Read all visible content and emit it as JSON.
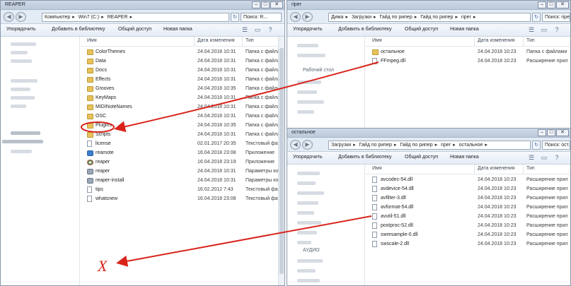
{
  "colors": {
    "arrow": "#d9231a",
    "folder": "#e7c15a",
    "titlebar": "#c6d3e3"
  },
  "toolbar": {
    "organize": "Упорядочить",
    "add_to_library": "Добавить в библиотеку",
    "share": "Общий доступ",
    "new_folder": "Новая папка"
  },
  "columns": {
    "name": "Имя",
    "date": "Дата изменения",
    "type": "Тип"
  },
  "win_reaper": {
    "title": "REAPER",
    "crumbs": [
      "Компьютер",
      "Win7 (C:)",
      "REAPER"
    ],
    "search": "Поиск: R...",
    "rows": [
      {
        "icon": "folder",
        "name": "ColorThemes",
        "date": "24.04.2018 10:31",
        "type": "Папка с файлами"
      },
      {
        "icon": "folder",
        "name": "Data",
        "date": "24.04.2018 10:31",
        "type": "Папка с файлами"
      },
      {
        "icon": "folder",
        "name": "Docs",
        "date": "24.04.2018 10:31",
        "type": "Папка с файлами"
      },
      {
        "icon": "folder",
        "name": "Effects",
        "date": "24.04.2018 10:31",
        "type": "Папка с файлами"
      },
      {
        "icon": "folder",
        "name": "Grooves",
        "date": "24.04.2018 10:35",
        "type": "Папка с файлами"
      },
      {
        "icon": "folder",
        "name": "KeyMaps",
        "date": "24.04.2018 10:31",
        "type": "Папка с файлами"
      },
      {
        "icon": "folder",
        "name": "MIDINoteNames",
        "date": "24.04.2018 10:31",
        "type": "Папка с файлами"
      },
      {
        "icon": "folder",
        "name": "OSC",
        "date": "24.04.2018 10:31",
        "type": "Папка с файлами"
      },
      {
        "icon": "folder",
        "name": "Plugins",
        "date": "24.04.2018 10:35",
        "type": "Папка с файлами"
      },
      {
        "icon": "folder",
        "name": "Scripts",
        "date": "24.04.2018 10:31",
        "type": "Папка с файлами"
      },
      {
        "icon": "file",
        "name": "license",
        "date": "02.01.2017 20:35",
        "type": "Текстовый файл"
      },
      {
        "icon": "app",
        "name": "reamote",
        "date": "16.04.2018 23:08",
        "type": "Приложение"
      },
      {
        "icon": "reaper",
        "name": "reaper",
        "date": "16.04.2018 23:19",
        "type": "Приложение"
      },
      {
        "icon": "gear",
        "name": "reaper",
        "date": "24.04.2018 10:31",
        "type": "Параметры конфигу..."
      },
      {
        "icon": "gear",
        "name": "reaper-install",
        "date": "24.04.2018 10:31",
        "type": "Параметры конфигу..."
      },
      {
        "icon": "file",
        "name": "tips",
        "date": "16.02.2012 7:43",
        "type": "Текстовый файл"
      },
      {
        "icon": "file",
        "name": "whatsnew",
        "date": "16.04.2018 23:08",
        "type": "Текстовый файл"
      }
    ]
  },
  "win_riper": {
    "title": "riper",
    "crumbs": [
      "Дима",
      "Загрузки",
      "Гайд по рипер",
      "Гайд по рипер",
      "riper"
    ],
    "search": "Поиск: riper",
    "nav_text": "Рабочий стол",
    "rows": [
      {
        "icon": "folder",
        "name": "остальное",
        "date": "24.04.2018 10:23",
        "type": "Папка с файлами"
      },
      {
        "icon": "file",
        "name": "FFmpeg.dll",
        "date": "24.04.2018 10:23",
        "type": "Расширение прил"
      }
    ]
  },
  "win_ost": {
    "title": "остальное",
    "crumbs": [
      "Загрузки",
      "Гайд по рипер",
      "Гайд по рипер",
      "riper",
      "остальное"
    ],
    "search": "Поиск: ост...",
    "nav_text": "АУДИО",
    "rows": [
      {
        "icon": "file",
        "name": "avcodec-54.dll",
        "date": "24.04.2018 10:23",
        "type": "Расширение прил"
      },
      {
        "icon": "file",
        "name": "avdevice-54.dll",
        "date": "24.04.2018 10:23",
        "type": "Расширение прил"
      },
      {
        "icon": "file",
        "name": "avfilter-3.dll",
        "date": "24.04.2018 10:23",
        "type": "Расширение прил"
      },
      {
        "icon": "file",
        "name": "avformat-54.dll",
        "date": "24.04.2018 10:23",
        "type": "Расширение прил"
      },
      {
        "icon": "file",
        "name": "avutil-51.dll",
        "date": "24.04.2018 10:23",
        "type": "Расширение прил"
      },
      {
        "icon": "file",
        "name": "postproc-52.dll",
        "date": "24.04.2018 10:23",
        "type": "Расширение прил"
      },
      {
        "icon": "file",
        "name": "swresample-0.dll",
        "date": "24.04.2018 10:23",
        "type": "Расширение прил"
      },
      {
        "icon": "file",
        "name": "swscale-2.dll",
        "date": "24.04.2018 10:23",
        "type": "Расширение прил"
      }
    ]
  },
  "annotations": {
    "x_mark": "X"
  }
}
